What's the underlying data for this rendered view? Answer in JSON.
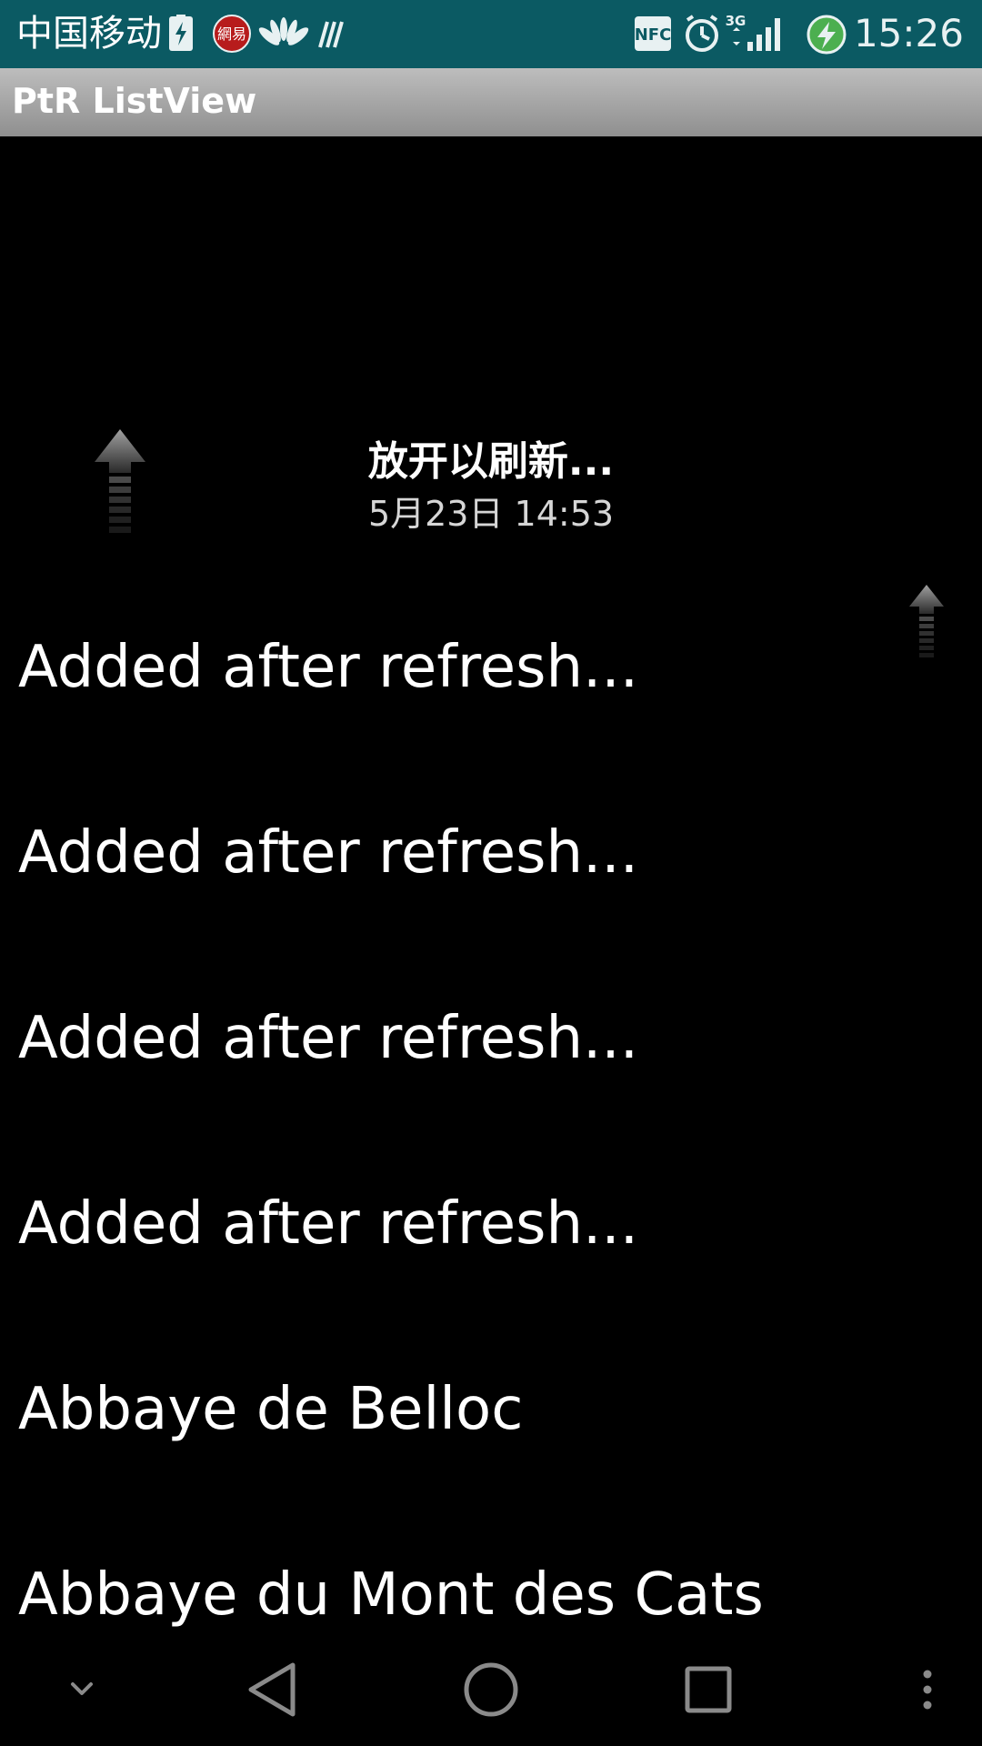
{
  "status_bar": {
    "carrier": "中国移动",
    "network_type": "3G",
    "nfc_label": "NFC",
    "netease_label": "網易",
    "time": "15:26",
    "icons": [
      "battery-saver-icon",
      "netease-icon",
      "huawei-icon",
      "signal-bars-icon",
      "nfc-icon",
      "alarm-icon",
      "cell-signal-icon",
      "charging-icon"
    ]
  },
  "action_bar": {
    "title": "PtR ListView"
  },
  "pull_to_refresh": {
    "label": "放开以刷新...",
    "last_updated": "5月23日 14:53",
    "icon": "arrow-up-icon"
  },
  "list": {
    "items": [
      "Added after refresh...",
      "Added after refresh...",
      "Added after refresh...",
      "Added after refresh...",
      "Abbaye de Belloc",
      "Abbaye du Mont des Cats"
    ]
  },
  "nav_bar": {
    "buttons": [
      "hide-nav-icon",
      "back-icon",
      "home-icon",
      "recents-icon",
      "more-icon"
    ]
  },
  "colors": {
    "status_bar": "#0b5a63",
    "action_bar_top": "#bdbdbd",
    "action_bar_bottom": "#8f8f8f",
    "background": "#000000",
    "text": "#ffffff"
  }
}
